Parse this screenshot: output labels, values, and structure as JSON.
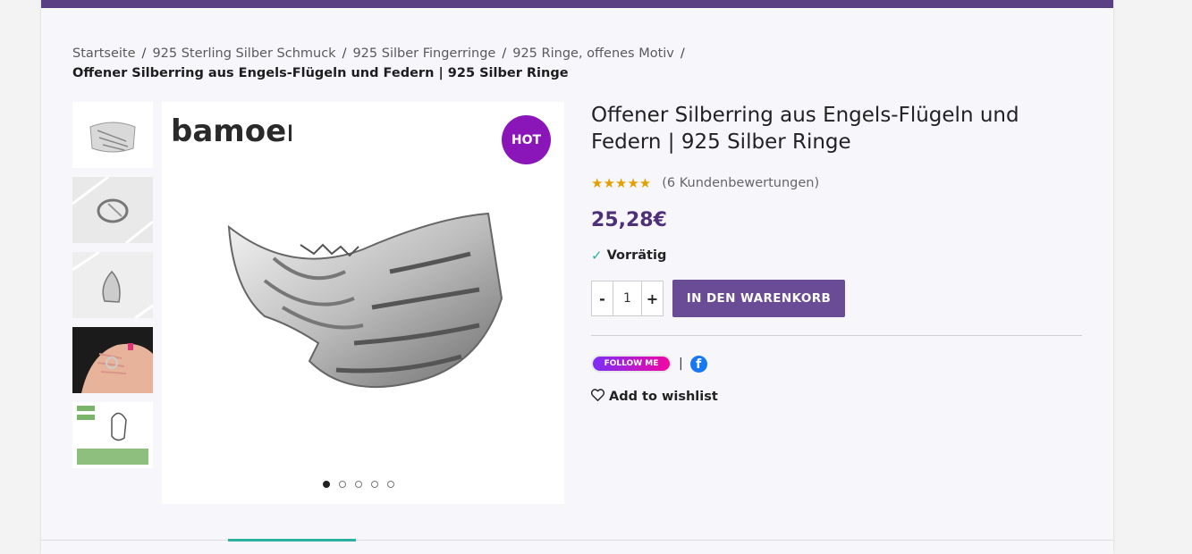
{
  "breadcrumb": {
    "items": [
      "Startseite",
      "925 Sterling Silber Schmuck",
      "925 Silber Fingerringe",
      "925 Ringe, offenes Motiv"
    ],
    "separator": "/",
    "current": "Offener Silberring aus Engels-Flügeln und Federn | 925 Silber Ringe"
  },
  "gallery": {
    "brand_logo_text": "bamoer",
    "badge": "HOT",
    "thumbnails": [
      "ring-front",
      "ring-side-box",
      "ring-angled",
      "ring-on-hand",
      "ring-size-chart"
    ],
    "slide_count": 5,
    "active_slide": 1
  },
  "product": {
    "title": "Offener Silberring aus Engels-Flügeln und Federn | 925 Silber Ringe",
    "stars": "★★★★★",
    "review_text": "(6 Kundenbewertungen)",
    "price": "25,28€",
    "stock": "Vorrätig",
    "qty_minus": "-",
    "qty_value": "1",
    "qty_plus": "+",
    "add_to_cart": "IN DEN WARENKORB",
    "follow_label": "FOLLOW ME",
    "pipe": "|",
    "facebook_letter": "f",
    "wishlist": "Add to wishlist"
  },
  "colors": {
    "brand_purple": "#5b3f84",
    "price_purple": "#4e2f7a",
    "cart_button": "#6a4b95",
    "hot_badge": "#8a16b9",
    "accent_teal": "#2bb0a0",
    "star_gold": "#e0a100"
  }
}
